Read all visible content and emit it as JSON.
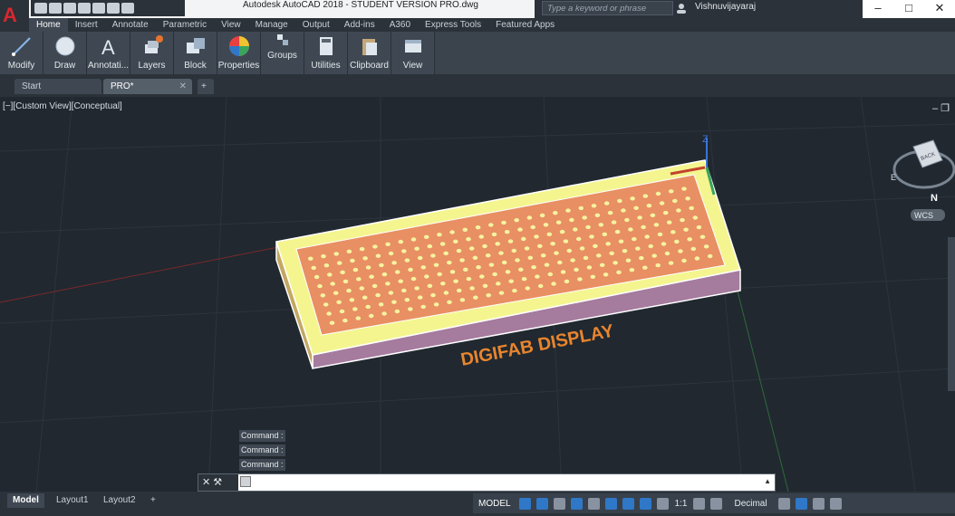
{
  "app": {
    "title": "Autodesk AutoCAD 2018 - STUDENT VERSION      PRO.dwg",
    "search_placeholder": "Type a keyword or phrase",
    "user": "Vishnuvijayaraj",
    "logo_letter": "A"
  },
  "ribbon_tabs": [
    "Home",
    "Insert",
    "Annotate",
    "Parametric",
    "View",
    "Manage",
    "Output",
    "Add-ins",
    "A360",
    "Express Tools",
    "Featured Apps"
  ],
  "ribbon_panels": [
    "Modify",
    "Draw",
    "Annotati...",
    "Layers",
    "Block",
    "Properties",
    "Groups",
    "Utilities",
    "Clipboard",
    "View"
  ],
  "doc_tabs": [
    "Start",
    "PRO*"
  ],
  "viewport": {
    "label": "[−][Custom View][Conceptual]",
    "model_text": "DIGIFAB DISPLAY",
    "viewcube_face": "BACK",
    "viewcube_top": "TOP",
    "compass_e": "E",
    "compass_n": "N",
    "wcs": "WCS",
    "ucs_z": "Z"
  },
  "command": {
    "history": [
      "Command :",
      "Command :",
      "Command :"
    ]
  },
  "status": {
    "layouts": [
      "Model",
      "Layout1",
      "Layout2"
    ],
    "model_label": "MODEL",
    "scale": "1:1",
    "units": "Decimal"
  },
  "colors": {
    "accent": "#2f77c7",
    "model_text": "#e8852d",
    "pcb": "#e88f63",
    "frame": "#f4f58f",
    "base": "#a57b9e"
  }
}
